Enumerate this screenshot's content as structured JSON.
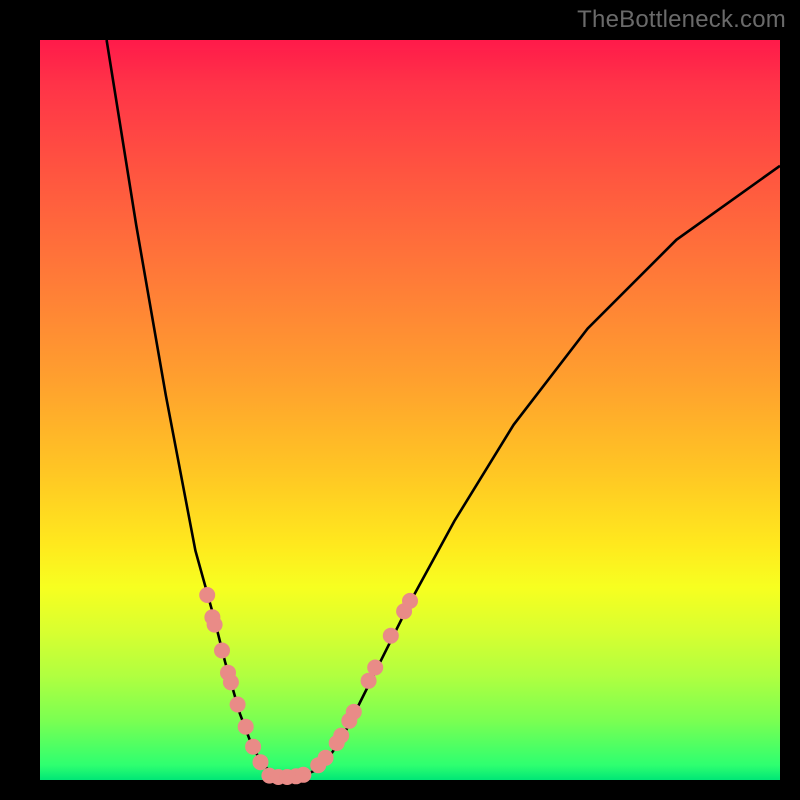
{
  "watermark": "TheBottleneck.com",
  "chart_data": {
    "type": "line",
    "title": "",
    "xlabel": "",
    "ylabel": "",
    "xlim": [
      0,
      100
    ],
    "ylim": [
      0,
      100
    ],
    "curve": {
      "name": "bottleneck-curve",
      "points": [
        {
          "x": 9,
          "y": 100
        },
        {
          "x": 13,
          "y": 75
        },
        {
          "x": 17,
          "y": 52
        },
        {
          "x": 21,
          "y": 31
        },
        {
          "x": 23.5,
          "y": 22
        },
        {
          "x": 25,
          "y": 16
        },
        {
          "x": 27,
          "y": 9
        },
        {
          "x": 28.5,
          "y": 5
        },
        {
          "x": 30,
          "y": 2.2
        },
        {
          "x": 31.5,
          "y": 0.8
        },
        {
          "x": 33,
          "y": 0.4
        },
        {
          "x": 35,
          "y": 0.4
        },
        {
          "x": 37,
          "y": 1.2
        },
        {
          "x": 39,
          "y": 3
        },
        {
          "x": 41,
          "y": 6
        },
        {
          "x": 43,
          "y": 10
        },
        {
          "x": 46,
          "y": 16
        },
        {
          "x": 50,
          "y": 24
        },
        {
          "x": 56,
          "y": 35
        },
        {
          "x": 64,
          "y": 48
        },
        {
          "x": 74,
          "y": 61
        },
        {
          "x": 86,
          "y": 73
        },
        {
          "x": 100,
          "y": 83
        }
      ]
    },
    "series": [
      {
        "name": "left-segment-markers",
        "type": "scatter",
        "color": "#e98b87",
        "points": [
          {
            "x": 22.6,
            "y": 25.0
          },
          {
            "x": 23.3,
            "y": 22.0
          },
          {
            "x": 23.6,
            "y": 21.0
          },
          {
            "x": 24.6,
            "y": 17.5
          },
          {
            "x": 25.4,
            "y": 14.5
          },
          {
            "x": 25.8,
            "y": 13.2
          },
          {
            "x": 26.7,
            "y": 10.2
          },
          {
            "x": 27.8,
            "y": 7.2
          },
          {
            "x": 28.8,
            "y": 4.5
          },
          {
            "x": 29.8,
            "y": 2.4
          }
        ]
      },
      {
        "name": "trough-markers",
        "type": "scatter",
        "color": "#e98b87",
        "points": [
          {
            "x": 31.0,
            "y": 0.6
          },
          {
            "x": 32.2,
            "y": 0.4
          },
          {
            "x": 33.4,
            "y": 0.4
          },
          {
            "x": 34.6,
            "y": 0.5
          },
          {
            "x": 35.6,
            "y": 0.7
          }
        ]
      },
      {
        "name": "right-segment-markers",
        "type": "scatter",
        "color": "#e98b87",
        "points": [
          {
            "x": 37.6,
            "y": 2.0
          },
          {
            "x": 38.6,
            "y": 3.0
          },
          {
            "x": 40.1,
            "y": 5.0
          },
          {
            "x": 40.7,
            "y": 6.0
          },
          {
            "x": 41.8,
            "y": 8.0
          },
          {
            "x": 42.4,
            "y": 9.2
          },
          {
            "x": 44.4,
            "y": 13.4
          },
          {
            "x": 45.3,
            "y": 15.2
          },
          {
            "x": 47.4,
            "y": 19.5
          },
          {
            "x": 49.2,
            "y": 22.8
          },
          {
            "x": 50.0,
            "y": 24.2
          }
        ]
      }
    ],
    "gradient_stops": [
      {
        "pos": 0,
        "color": "#ff1a4a"
      },
      {
        "pos": 50,
        "color": "#ffc524"
      },
      {
        "pos": 100,
        "color": "#00e676"
      }
    ]
  }
}
